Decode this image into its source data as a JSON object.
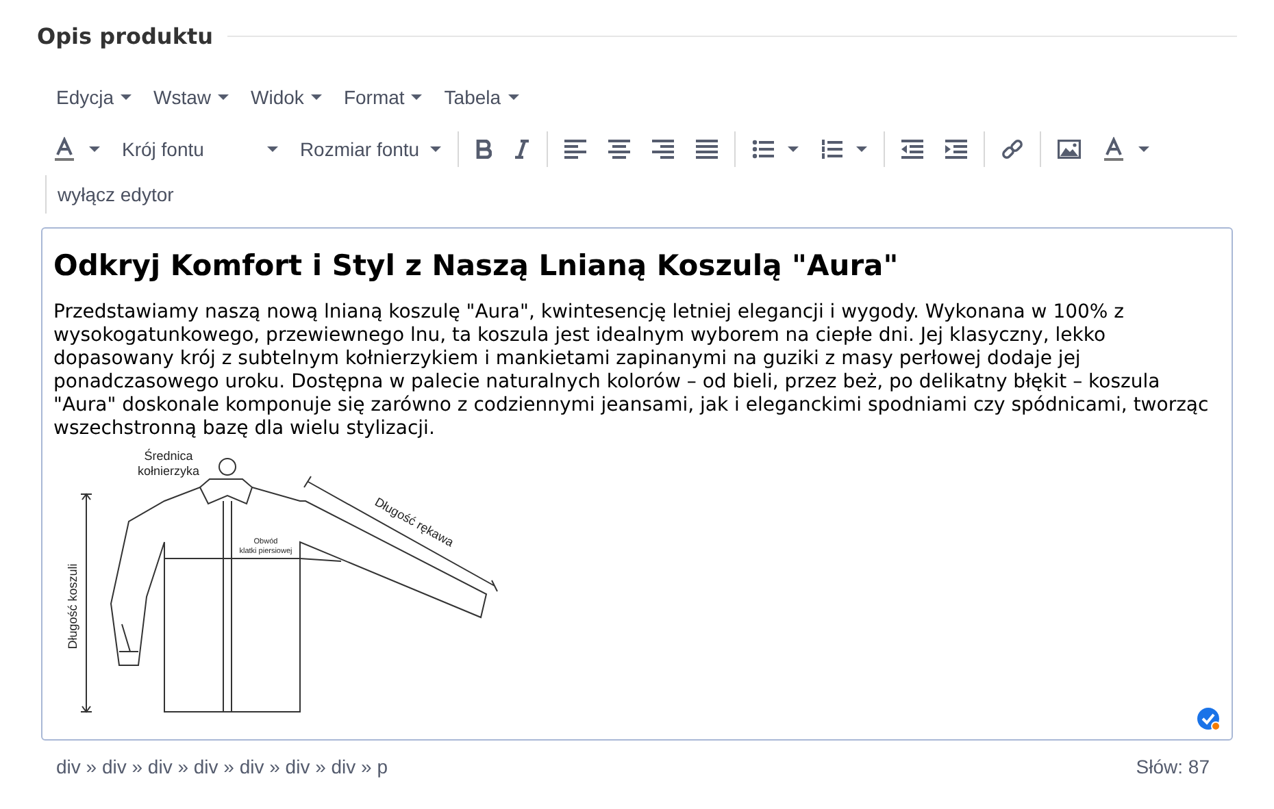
{
  "section_title": "Opis produktu",
  "menu": [
    {
      "label": "Edycja"
    },
    {
      "label": "Wstaw"
    },
    {
      "label": "Widok"
    },
    {
      "label": "Format"
    },
    {
      "label": "Tabela"
    }
  ],
  "toolbar": [
    {
      "kind": "text-color"
    },
    {
      "kind": "select",
      "label": "Krój fontu"
    },
    {
      "kind": "select",
      "label": "Rozmiar fontu"
    },
    {
      "kind": "separator"
    },
    {
      "kind": "bold"
    },
    {
      "kind": "italic"
    },
    {
      "kind": "separator"
    },
    {
      "kind": "align-left"
    },
    {
      "kind": "align-center"
    },
    {
      "kind": "align-right"
    },
    {
      "kind": "align-justify"
    },
    {
      "kind": "separator"
    },
    {
      "kind": "bullet-list"
    },
    {
      "kind": "numbered-list"
    },
    {
      "kind": "separator"
    },
    {
      "kind": "outdent"
    },
    {
      "kind": "indent"
    },
    {
      "kind": "separator"
    },
    {
      "kind": "link"
    },
    {
      "kind": "separator"
    },
    {
      "kind": "image"
    },
    {
      "kind": "background-color"
    }
  ],
  "disable_editor": "wyłącz edytor",
  "document": {
    "heading": "Odkryj Komfort i Styl z Naszą Lnianą Koszulą \"Aura\"",
    "paragraph": "Przedstawiamy naszą nową lnianą koszulę \"Aura\", kwintesencję letniej elegancji i wygody. Wykonana w 100% z wysokogatunkowego, przewiewnego lnu, ta koszula jest idealnym wyborem na ciepłe dni. Jej klasyczny, lekko dopasowany krój z subtelnym kołnierzykiem i mankietami zapinanymi na guziki z masy perłowej dodaje jej ponadczasowego uroku. Dostępna w palecie naturalnych kolorów – od bieli, przez beż, po delikatny błękit – koszula \"Aura\" doskonale komponuje się zarówno z codziennymi jeansami, jak i eleganckimi spodniami czy spódnicami, tworząc wszechstronną bazę dla wielu stylizacji.",
    "figure": {
      "collar_label": [
        "Średnica",
        "kołnierzyka"
      ],
      "length_label": "Długość koszuli",
      "chest_label": [
        "Obwód",
        "klatki piersiowej"
      ],
      "sleeve_label": "Długość rękawa"
    }
  },
  "status_bar": {
    "path": "div » div » div » div » div » div » div » p",
    "word_count": "Słów: 87"
  }
}
